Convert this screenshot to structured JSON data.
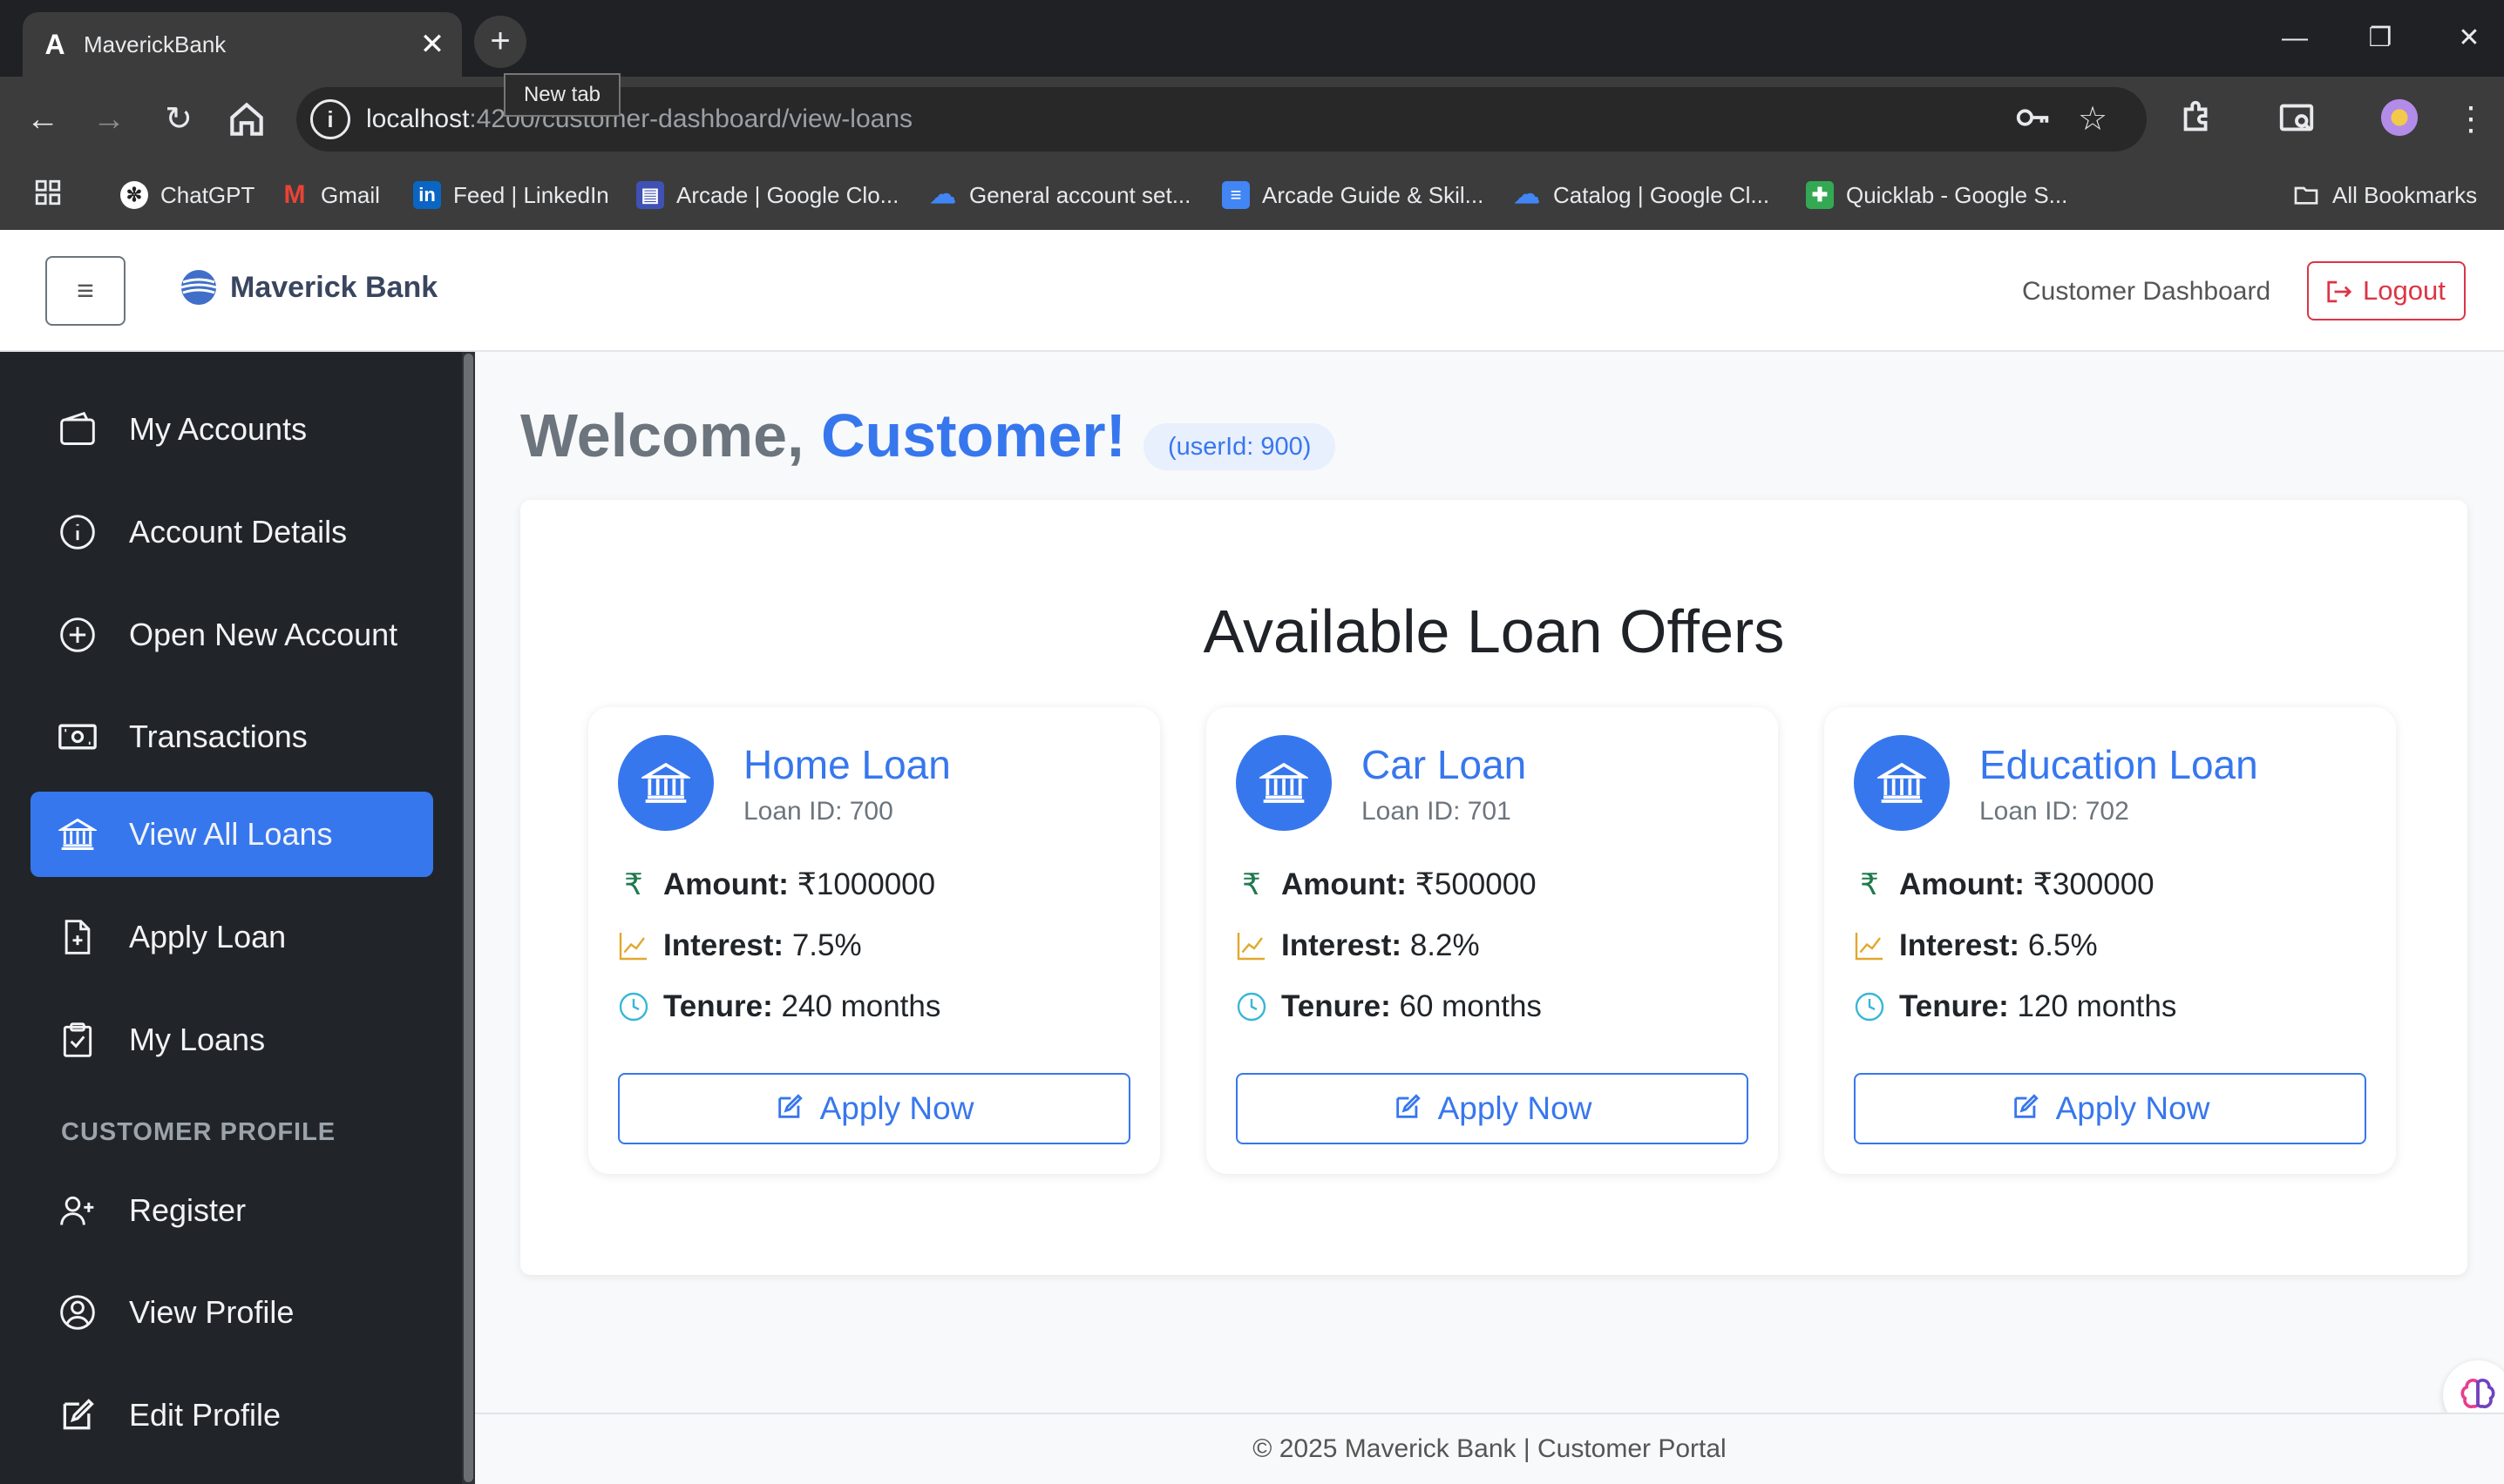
{
  "browser": {
    "tab_title": "MaverickBank",
    "tab_favicon": "A",
    "tab_close": "✕",
    "new_tab_label": "+",
    "tooltip": "New tab",
    "url_host": "localhost",
    "url_path": ":4200/customer-dashboard/view-loans",
    "bookmarks": [
      {
        "label": "ChatGPT",
        "icon": "chatgpt-icon"
      },
      {
        "label": "Gmail",
        "icon": "gmail-icon"
      },
      {
        "label": "Feed | LinkedIn",
        "icon": "linkedin-icon"
      },
      {
        "label": "Arcade | Google Clo...",
        "icon": "arcade-icon"
      },
      {
        "label": "General account set...",
        "icon": "google-cloud-icon"
      },
      {
        "label": "Arcade Guide & Skil...",
        "icon": "docs-icon"
      },
      {
        "label": "Catalog | Google Cl...",
        "icon": "google-cloud-icon"
      },
      {
        "label": "Quicklab - Google S...",
        "icon": "sheets-icon"
      }
    ],
    "all_bookmarks": "All Bookmarks"
  },
  "header": {
    "brand": "Maverick Bank",
    "menu_glyph": "≡",
    "nav_link": "Customer Dashboard",
    "logout": "Logout"
  },
  "sidebar": {
    "items": [
      {
        "label": "My Accounts",
        "icon": "wallet-icon"
      },
      {
        "label": "Account Details",
        "icon": "info-icon"
      },
      {
        "label": "Open New Account",
        "icon": "plus-circle-icon"
      },
      {
        "label": "Transactions",
        "icon": "cash-icon"
      },
      {
        "label": "View All Loans",
        "icon": "bank-icon",
        "active": true
      },
      {
        "label": "Apply Loan",
        "icon": "file-plus-icon"
      },
      {
        "label": "My Loans",
        "icon": "clipboard-check-icon"
      }
    ],
    "section_title": "CUSTOMER PROFILE",
    "profile_items": [
      {
        "label": "Register",
        "icon": "person-plus-icon"
      },
      {
        "label": "View Profile",
        "icon": "person-circle-icon"
      },
      {
        "label": "Edit Profile",
        "icon": "pencil-square-icon"
      }
    ]
  },
  "main": {
    "welcome_prefix": "Welcome, ",
    "welcome_name": "Customer!",
    "user_badge": "(userId: 900)",
    "panel_title": "Available Loan Offers",
    "labels": {
      "amount": "Amount:",
      "interest": "Interest:",
      "tenure": "Tenure:"
    },
    "apply_label": "Apply Now",
    "loans": [
      {
        "name": "Home Loan",
        "id": "Loan ID: 700",
        "amount": " ₹1000000",
        "interest": " 7.5%",
        "tenure": " 240 months"
      },
      {
        "name": "Car Loan",
        "id": "Loan ID: 701",
        "amount": " ₹500000",
        "interest": " 8.2%",
        "tenure": " 60 months"
      },
      {
        "name": "Education Loan",
        "id": "Loan ID: 702",
        "amount": " ₹300000",
        "interest": " 6.5%",
        "tenure": " 120 months"
      }
    ]
  },
  "footer": {
    "text": "© 2025 Maverick Bank | Customer Portal"
  },
  "colors": {
    "accent": "#3777ee",
    "danger": "#dc3545",
    "sidebar": "#212529",
    "rupee": "#1f7a4d",
    "interest": "#e0a82e",
    "tenure": "#38b6d8"
  }
}
